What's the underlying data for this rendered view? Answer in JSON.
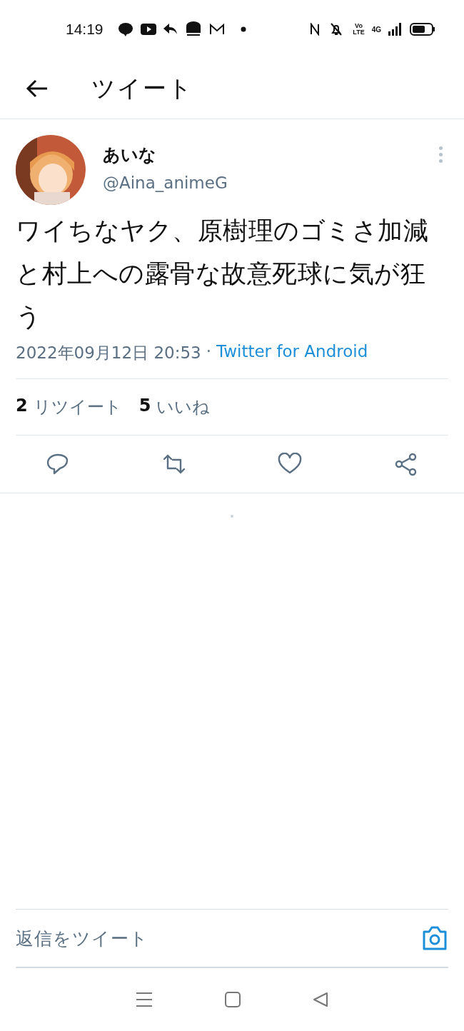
{
  "status_bar": {
    "time": "14:19",
    "volte": "Vo LTE",
    "network": "4G"
  },
  "header": {
    "title": "ツイート"
  },
  "tweet": {
    "display_name": "あいな",
    "handle": "@Aina_animeG",
    "text": "ワイちなヤク、原樹理のゴミさ加減と村上への露骨な故意死球に気が狂う",
    "timestamp": "2022年09月12日 20:53",
    "separator": "·",
    "source": "Twitter for Android",
    "stats": [
      {
        "count": "2",
        "label": "リツイート"
      },
      {
        "count": "5",
        "label": "いいね"
      }
    ],
    "actions": [
      {
        "kind": "reply"
      },
      {
        "kind": "retweet"
      },
      {
        "kind": "like"
      },
      {
        "kind": "share"
      }
    ]
  },
  "reply_bar": {
    "placeholder": "返信をツイート"
  }
}
